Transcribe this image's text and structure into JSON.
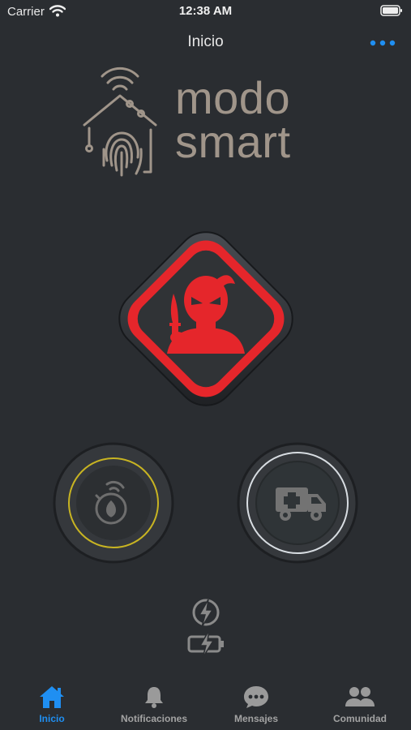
{
  "status_bar": {
    "carrier": "Carrier",
    "time": "12:38 AM"
  },
  "nav": {
    "title": "Inicio",
    "more_icon": "more-dots-icon"
  },
  "logo": {
    "line1": "modo",
    "line2": "smart"
  },
  "buttons": {
    "panic_icon": "intruder-alert-icon",
    "fire_icon": "fire-alarm-icon",
    "ambulance_icon": "ambulance-icon"
  },
  "power": {
    "icons": [
      "lightning-circle-icon",
      "battery-charging-icon"
    ]
  },
  "tabs": [
    {
      "label": "Inicio",
      "icon": "home-icon",
      "active": true
    },
    {
      "label": "Notificaciones",
      "icon": "bell-icon",
      "active": false
    },
    {
      "label": "Mensajes",
      "icon": "chat-bubble-icon",
      "active": false
    },
    {
      "label": "Comunidad",
      "icon": "people-icon",
      "active": false
    }
  ],
  "colors": {
    "background": "#2a2d31",
    "accent": "#1f8ff2",
    "alarm_red": "#e5262b",
    "fire_ring": "#c8b422",
    "logo": "#a0958a"
  }
}
